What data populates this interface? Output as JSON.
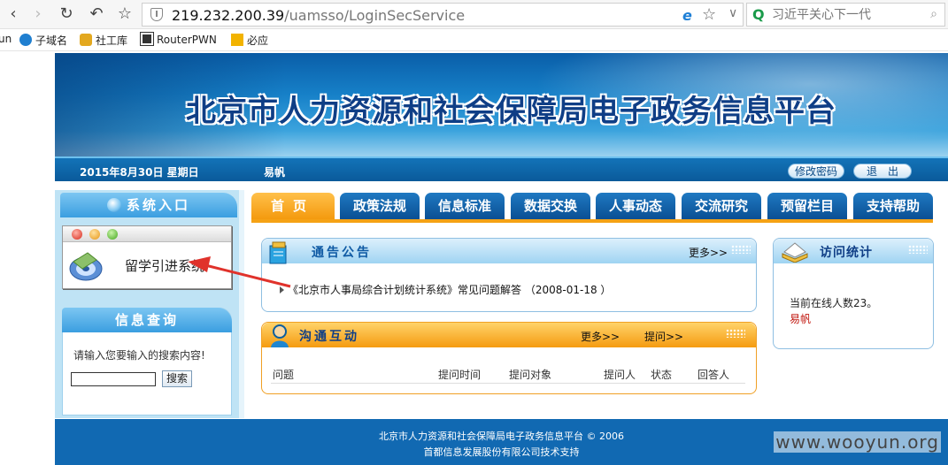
{
  "browser": {
    "url_host": "219.232.200.39",
    "url_path": "/uamsso/LoginSecService",
    "search_placeholder": "习近平关心下一代",
    "bookmarks": [
      {
        "label": "un",
        "icon": "bookmark-icon"
      },
      {
        "label": "子域名",
        "icon": "subdomain-icon"
      },
      {
        "label": "社工库",
        "icon": "key-icon"
      },
      {
        "label": "RouterPWN",
        "icon": "router-icon"
      },
      {
        "label": "必应",
        "icon": "bing-icon"
      }
    ]
  },
  "header": {
    "title": "北京市人力资源和社会保障局电子政务信息平台",
    "date": "2015年8月30日  星期日",
    "user": "易帆",
    "change_password": "修改密码",
    "logout": "退　出"
  },
  "nav": {
    "tabs": [
      "首页",
      "政策法规",
      "信息标准",
      "数据交换",
      "人事动态",
      "交流研究",
      "预留栏目",
      "支持帮助"
    ],
    "active": "首页"
  },
  "left": {
    "system_entry_title": "系统入口",
    "system_item": "留学引进系统",
    "query_title": "信息查询",
    "query_prompt": "请输入您要输入的搜索内容!",
    "query_value": "",
    "search_button": "搜索"
  },
  "notice": {
    "title": "通告公告",
    "more": "更多>>",
    "item": "《北京市人事局综合计划统计系统》常见问题解答",
    "item_date": "（2008-01-18 ）"
  },
  "talk": {
    "title": "沟通互动",
    "more": "更多>>",
    "ask": "提问>>",
    "columns": [
      "问题",
      "提问时间",
      "提问对象",
      "提问人",
      "状态",
      "回答人"
    ]
  },
  "stats": {
    "title": "访问统计",
    "online": "当前在线人数23。",
    "user": "易帆"
  },
  "footer": {
    "line1": "北京市人力资源和社会保障局电子政务信息平台 © 2006",
    "line2": "首都信息发展股份有限公司技术支持"
  },
  "watermark": "www.wooyun.org",
  "colors": {
    "nav_blue": "#0a4f93",
    "nav_orange": "#f49a0e",
    "annotation_arrow": "#e0322b"
  }
}
